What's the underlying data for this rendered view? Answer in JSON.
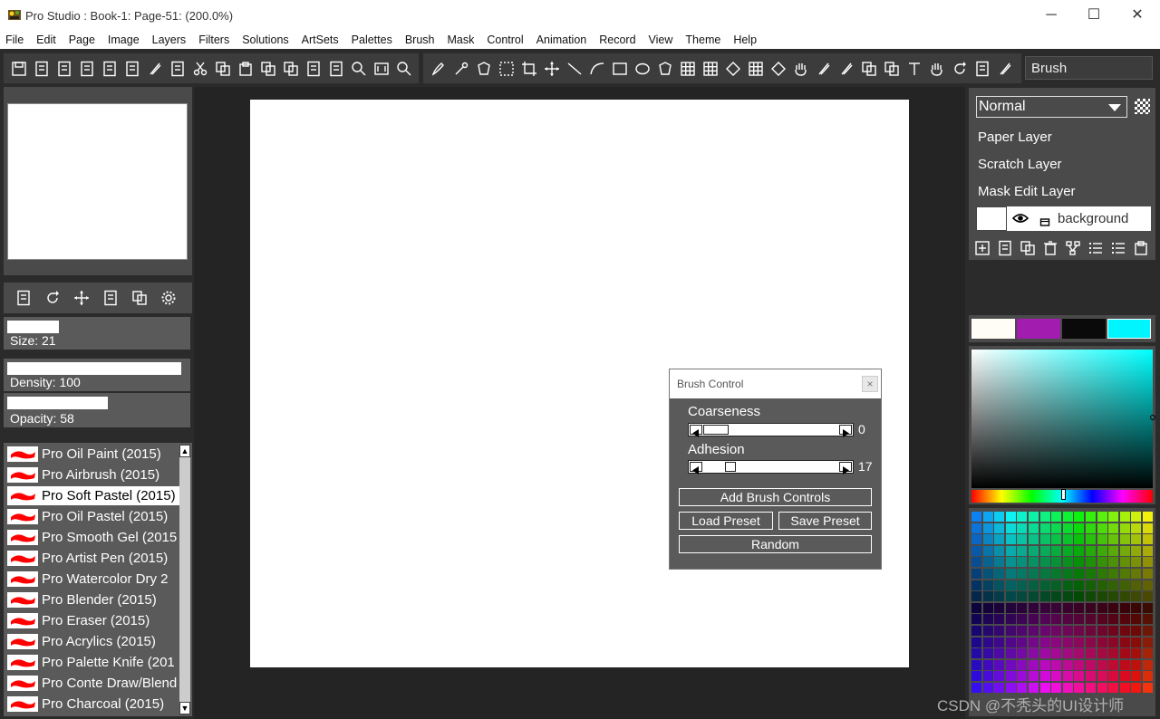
{
  "window": {
    "title": "Pro Studio : Book-1: Page-51:  (200.0%)"
  },
  "menu": [
    "File",
    "Edit",
    "Page",
    "Image",
    "Layers",
    "Filters",
    "Solutions",
    "ArtSets",
    "Palettes",
    "Brush",
    "Mask",
    "Control",
    "Animation",
    "Record",
    "View",
    "Theme",
    "Help"
  ],
  "toolbar": {
    "current_tool": "Brush"
  },
  "sliders": {
    "size_label": "Size: 21",
    "size_fill": 0.29,
    "density_label": "Density: 100",
    "density_fill": 0.97,
    "opacity_label": "Opacity: 58",
    "opacity_fill": 0.56
  },
  "brushes": [
    "Pro Oil Paint (2015)",
    "Pro Airbrush (2015)",
    "Pro Soft Pastel (2015)",
    "Pro Oil Pastel (2015)",
    "Pro Smooth Gel (2015",
    "Pro Artist Pen (2015)",
    "Pro Watercolor Dry 2",
    "Pro Blender (2015)",
    "Pro Eraser (2015)",
    "Pro Acrylics (2015)",
    "Pro Palette Knife (201",
    "Pro Conte Draw/Blend",
    "Pro Charcoal (2015)"
  ],
  "selected_brush_index": 2,
  "brush_control": {
    "title": "Brush Control",
    "coarseness_label": "Coarseness",
    "coarseness_value": "0",
    "coarseness_fraction": 0,
    "adhesion_label": "Adhesion",
    "adhesion_value": "17",
    "adhesion_fraction": 0.17,
    "add_controls": "Add Brush Controls",
    "load_preset": "Load Preset",
    "save_preset": "Save Preset",
    "random": "Random",
    "close_glyph": "×"
  },
  "layers": {
    "blend_mode": "Normal",
    "items": [
      "Paper Layer",
      "Scratch Layer",
      "Mask Edit Layer"
    ],
    "active_layer": "background"
  },
  "swatches": [
    "#fffdf5",
    "#a21caf",
    "#0a0a0a",
    "#00f5ff"
  ],
  "colors": {
    "accent": "#ff0000",
    "panel": "#4a4a4a"
  },
  "watermark": "CSDN @不秃头的UI设计师"
}
